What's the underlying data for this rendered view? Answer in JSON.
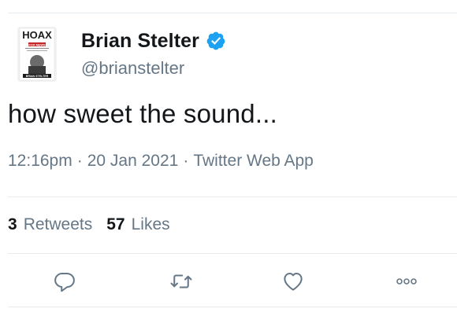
{
  "author": {
    "name": "Brian Stelter",
    "handle": "@brianstelter",
    "verified": true,
    "avatar": {
      "headline": "HOAX",
      "subline": "FOX NEWS",
      "footer": "BRIAN STELTER"
    }
  },
  "tweet": {
    "text": "how sweet the sound...",
    "time": "12:16pm",
    "separator": "·",
    "date": "20 Jan 2021",
    "source": "Twitter Web App"
  },
  "stats": {
    "retweets_count": "3",
    "retweets_label": "Retweets",
    "likes_count": "57",
    "likes_label": "Likes"
  },
  "actions": [
    "reply-icon",
    "retweet-icon",
    "like-icon",
    "more-icon"
  ],
  "colors": {
    "text": "#14171a",
    "secondary": "#657786",
    "divider": "#e6ecf0",
    "verified": "#1da1f2"
  }
}
